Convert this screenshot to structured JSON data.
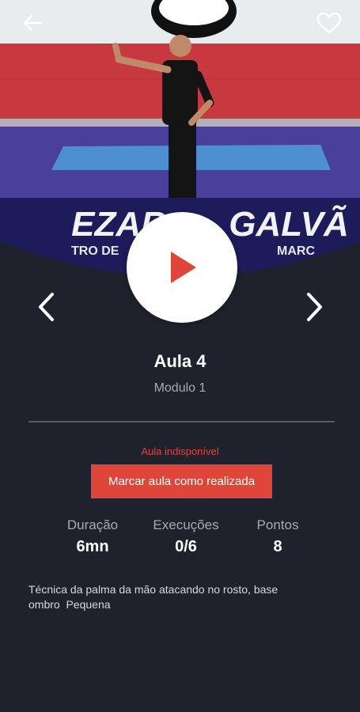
{
  "lesson": {
    "title": "Aula 4",
    "module": "Modulo 1",
    "status": "Aula indisponível",
    "mark_button_label": "Marcar aula como realizada",
    "description": "Técnica da palma da mão atacando no rosto, base\nombro  Pequena"
  },
  "stats": [
    {
      "label": "Duração",
      "value": "6mn"
    },
    {
      "label": "Execuções",
      "value": "0/6"
    },
    {
      "label": "Pontos",
      "value": "8"
    }
  ],
  "video": {
    "banner_text": "EZAR  GALVÃ",
    "banner_subtext": "TRO DE       MARC"
  },
  "icons": {
    "back": "arrow-left-icon",
    "favorite": "heart-outline-icon",
    "play": "play-icon",
    "previous": "chevron-left-icon",
    "next": "chevron-right-icon"
  },
  "colors": {
    "background": "#1f212c",
    "accent": "#e0453a",
    "text_primary": "#ffffff",
    "text_secondary": "#a9aab0"
  }
}
